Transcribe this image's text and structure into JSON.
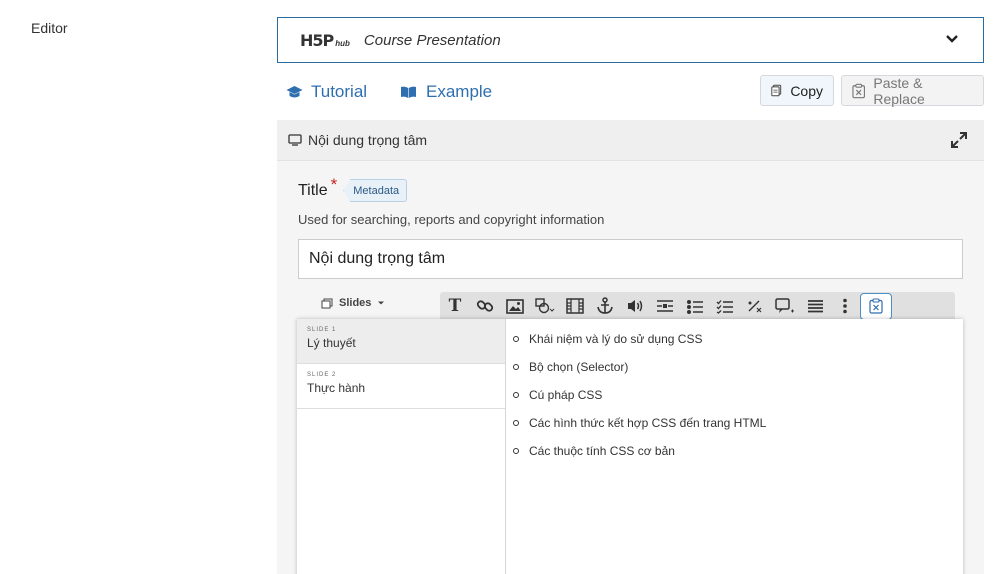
{
  "editor_label": "Editor",
  "library": {
    "logo_text": "H5P",
    "logo_suffix": "hub",
    "name": "Course Presentation"
  },
  "links": {
    "tutorial": "Tutorial",
    "example": "Example"
  },
  "buttons": {
    "copy": "Copy",
    "paste_replace": "Paste & Replace"
  },
  "panel": {
    "header_title": "Nội dung trọng tâm"
  },
  "title_field": {
    "label": "Title",
    "required_mark": "*",
    "metadata_tag": "Metadata",
    "description": "Used for searching, reports and copyright information",
    "value": "Nội dung trọng tâm"
  },
  "slides_dropdown": "Slides",
  "toolbar_icons": [
    "text-icon",
    "link-icon",
    "image-icon",
    "shapes-icon",
    "video-icon",
    "anchor-icon",
    "audio-icon",
    "fill-blanks-icon",
    "single-choice-icon",
    "multi-choice-icon",
    "math-icon",
    "dialog-icon",
    "list-icon",
    "more-icon",
    "paste-icon"
  ],
  "slides": [
    {
      "number": "SLIDE 1",
      "title": "Lý thuyết"
    },
    {
      "number": "SLIDE 2",
      "title": "Thực hành"
    }
  ],
  "bullets": [
    "Khái niệm và lý do sử dụng CSS",
    "Bộ chọn (Selector)",
    "Cú pháp CSS",
    "Các hình thức kết hợp CSS đến trang HTML",
    "Các thuộc tính CSS cơ bản"
  ]
}
